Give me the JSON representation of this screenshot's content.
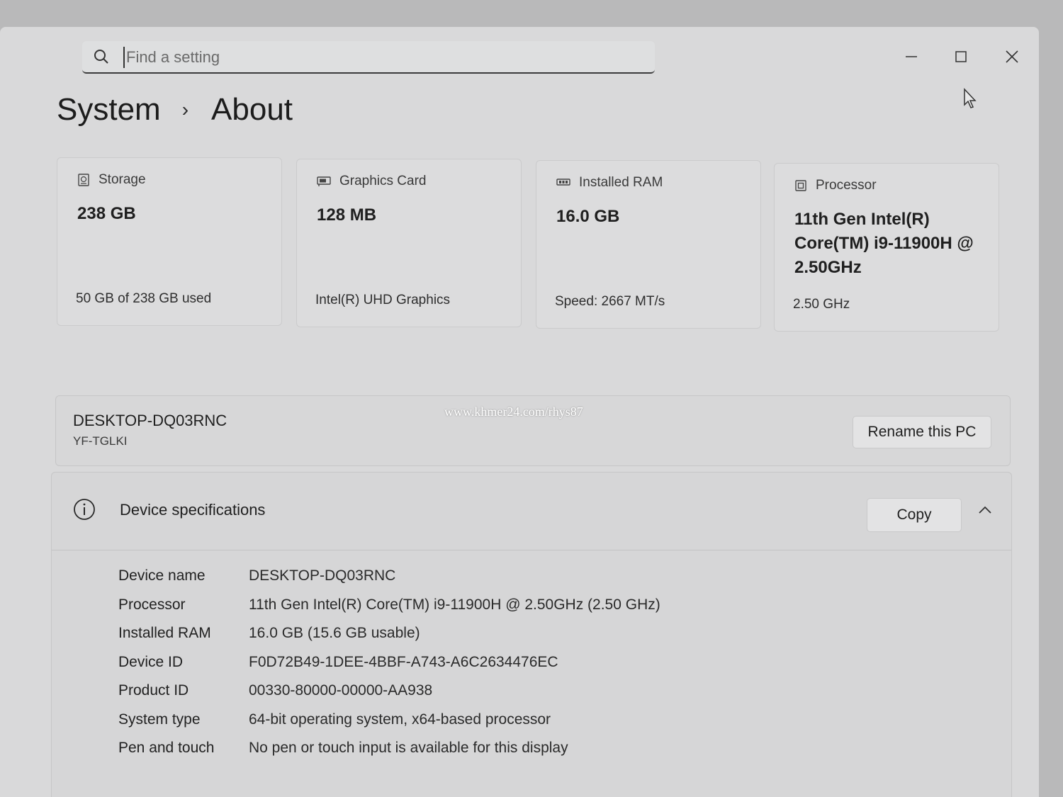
{
  "search": {
    "placeholder": "Find a setting"
  },
  "window_controls": {
    "minimize": "minimize-icon",
    "maximize": "maximize-icon",
    "close": "close-icon"
  },
  "breadcrumb": {
    "parent": "System",
    "separator": "›",
    "current": "About"
  },
  "cards": [
    {
      "icon": "storage-icon",
      "label": "Storage",
      "value": "238 GB",
      "sub": "50 GB of 238 GB used"
    },
    {
      "icon": "graphics-card-icon",
      "label": "Graphics Card",
      "value": "128 MB",
      "sub": "Intel(R) UHD Graphics"
    },
    {
      "icon": "ram-icon",
      "label": "Installed RAM",
      "value": "16.0 GB",
      "sub": "Speed: 2667 MT/s"
    },
    {
      "icon": "processor-icon",
      "label": "Processor",
      "value": "11th Gen Intel(R) Core(TM) i9-11900H @ 2.50GHz",
      "sub": "2.50 GHz"
    }
  ],
  "device": {
    "name": "DESKTOP-DQ03RNC",
    "model": "YF-TGLKI",
    "rename_label": "Rename this PC",
    "watermark": "www.khmer24.com/rhys87"
  },
  "specs": {
    "title": "Device specifications",
    "copy_label": "Copy",
    "rows": [
      {
        "key": "Device name",
        "value": "DESKTOP-DQ03RNC"
      },
      {
        "key": "Processor",
        "value": "11th Gen Intel(R) Core(TM) i9-11900H @ 2.50GHz (2.50 GHz)"
      },
      {
        "key": "Installed RAM",
        "value": "16.0 GB (15.6 GB usable)"
      },
      {
        "key": "Device ID",
        "value": "F0D72B49-1DEE-4BBF-A743-A6C2634476EC"
      },
      {
        "key": "Product ID",
        "value": "00330-80000-00000-AA938"
      },
      {
        "key": "System type",
        "value": "64-bit operating system, x64-based processor"
      },
      {
        "key": "Pen and touch",
        "value": "No pen or touch input is available for this display"
      }
    ]
  }
}
